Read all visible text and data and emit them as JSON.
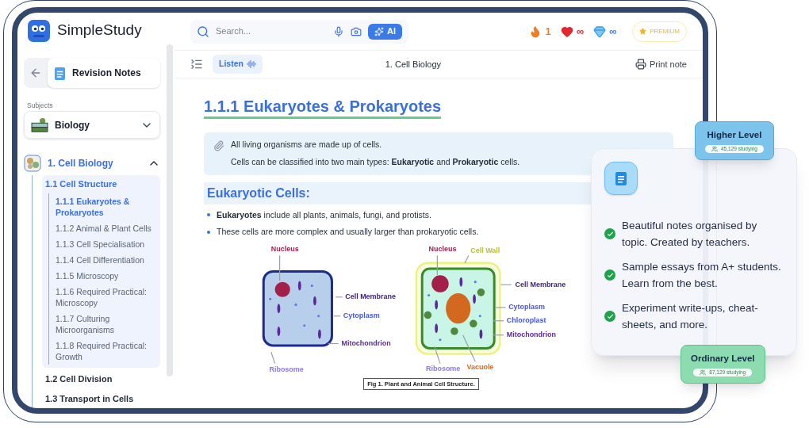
{
  "brand": {
    "name": "SimpleStudy"
  },
  "search": {
    "placeholder": "Search..."
  },
  "ai_button": {
    "label": "AI"
  },
  "stats": [
    {
      "kind": "streak",
      "value": "1"
    },
    {
      "kind": "lives",
      "value": "∞"
    },
    {
      "kind": "gems",
      "value": "∞"
    }
  ],
  "premium_button": {
    "label": "PREMIUM"
  },
  "sidebar": {
    "section_title": "Revision Notes",
    "subjects_label": "Subjects",
    "subject": "Biology",
    "tree": [
      {
        "title": "1. Cell Biology",
        "expanded": true,
        "children": [
          {
            "title": "1.1 Cell Structure",
            "selected": true,
            "expanded": true,
            "children": [
              {
                "title": "1.1.1 Eukaryotes & Prokaryotes",
                "selected": true
              },
              {
                "title": "1.1.2 Animal & Plant Cells",
                "selected": false
              },
              {
                "title": "1.1.3 Cell Specialisation",
                "selected": false
              },
              {
                "title": "1.1.4 Cell Differentiation",
                "selected": false
              },
              {
                "title": "1.1.5 Microscopy",
                "selected": false
              },
              {
                "title": "1.1.6 Required Practical: Microscopy",
                "selected": false
              },
              {
                "title": "1.1.7 Culturing Microorganisms",
                "selected": false
              },
              {
                "title": "1.1.8 Required Practical: Growth",
                "selected": false
              }
            ]
          },
          {
            "title": "1.2 Cell Division",
            "selected": false,
            "expanded": false
          },
          {
            "title": "1.3 Transport in Cells",
            "selected": false,
            "expanded": false
          }
        ]
      }
    ]
  },
  "toolbar": {
    "listen_button": "Listen",
    "title": "1. Cell Biology",
    "print_button": "Print note"
  },
  "article": {
    "heading": "1.1.1 Eukaryotes & Prokaryotes",
    "note": [
      "All living organisms are made up of cells.",
      "Cells can be classified into two main types: **Eukaryotic** and **Prokaryotic** cells."
    ],
    "subheading": "Eukaryotic Cells:",
    "bullets": [
      "**Eukaryotes** include all plants, animals, fungi, and protists.",
      "These cells are more complex and usually larger than prokaryotic cells."
    ],
    "figure": {
      "animal_labels": [
        "Nucleus",
        "Cell Membrane",
        "Cytoplasm",
        "Mitochondrion",
        "Ribosome"
      ],
      "plant_labels": [
        "Nucleus",
        "Cell Wall",
        "Cell Membrane",
        "Cytoplasm",
        "Chloroplast",
        "Mitochondrion",
        "Ribosome",
        "Vacuole"
      ],
      "caption": "Fig 1. Plant and Animal Cell Structure."
    }
  },
  "promo": {
    "features": [
      "Beautiful notes organised by topic. Created by teachers.",
      "Sample essays from A+ students. Learn from the best.",
      "Experiment write-ups, cheat-sheets, and more."
    ],
    "levels": [
      {
        "kind": "higher",
        "title": "Higher Level",
        "count": "45,129 studying"
      },
      {
        "kind": "ordinary",
        "title": "Ordinary Level",
        "count": "87,129 studying"
      }
    ]
  }
}
